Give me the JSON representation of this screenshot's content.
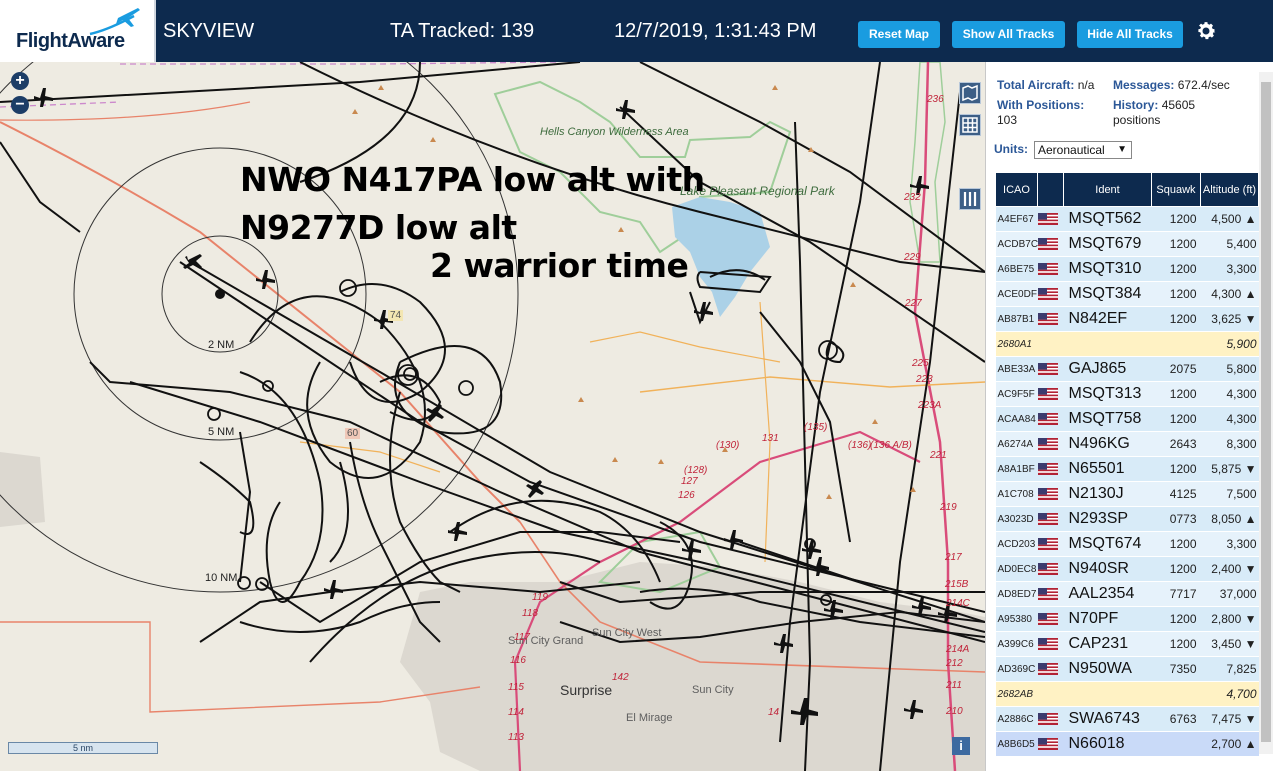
{
  "header": {
    "logo": "FlightAware",
    "app_name": "SKYVIEW",
    "tracked": "TA Tracked: 139",
    "datetime": "12/7/2019, 1:31:43 PM",
    "buttons": {
      "reset": "Reset Map",
      "show_all": "Show All Tracks",
      "hide_all": "Hide All Tracks"
    }
  },
  "colors": {
    "header_bg": "#0d2a4e",
    "button": "#1a9ce0",
    "table_header": "#0d2a4e",
    "row": "#d8ebf8",
    "row_no_ident": "#fff2c4",
    "row_selected": "#c9daf8"
  },
  "map": {
    "annotations": [
      "NWO N417PA low alt with",
      "N9277D low alt",
      "2 warrior time"
    ],
    "place_labels": {
      "hells_canyon": "Hells Canyon Wilderness Area",
      "lake_pleasant": "Lake Pleasant Regional Park",
      "sun_city_grand": "Sun City Grand",
      "sun_city_west": "Sun City West",
      "surprise": "Surprise",
      "sun_city": "Sun City",
      "el_mirage": "El Mirage"
    },
    "range_rings": [
      "2 NM",
      "5 NM",
      "10 NM"
    ],
    "highway_labels": [
      "74",
      "60",
      "(130)",
      "131",
      "(135)",
      "(128)",
      "127",
      "126",
      "(136)",
      "(136 A/B)",
      "236",
      "232",
      "229",
      "227",
      "225",
      "223",
      "223A",
      "221",
      "219",
      "217",
      "215B",
      "214C",
      "214A",
      "212",
      "211",
      "210",
      "119",
      "118",
      "117",
      "116",
      "115",
      "114",
      "113",
      "142",
      "14"
    ],
    "scale": "5 nm",
    "controls": {
      "zoom_in": "+",
      "zoom_out": "−",
      "info": "i"
    }
  },
  "panel": {
    "stats": {
      "total_aircraft_label": "Total Aircraft:",
      "total_aircraft_value": "n/a",
      "with_positions_label": "With Positions:",
      "with_positions_value": "103",
      "messages_label": "Messages:",
      "messages_value": "672.4/sec",
      "history_label": "History:",
      "history_value": "45605 positions"
    },
    "units_label": "Units:",
    "units_value": "Aeronautical",
    "columns": {
      "icao": "ICAO",
      "ident": "Ident",
      "squawk": "Squawk",
      "altitude": "Altitude (ft)"
    },
    "rows": [
      {
        "icao": "A4EF67",
        "ident": "MSQT562",
        "squawk": "1200",
        "altitude": "4,500 ▲"
      },
      {
        "icao": "ACDB7C",
        "ident": "MSQT679",
        "squawk": "1200",
        "altitude": "5,400"
      },
      {
        "icao": "A6BE75",
        "ident": "MSQT310",
        "squawk": "1200",
        "altitude": "3,300"
      },
      {
        "icao": "ACE0DF",
        "ident": "MSQT384",
        "squawk": "1200",
        "altitude": "4,300 ▲"
      },
      {
        "icao": "AB87B1",
        "ident": "N842EF",
        "squawk": "1200",
        "altitude": "3,625 ▼"
      },
      {
        "icao": "2680A1",
        "ident": "",
        "squawk": "",
        "altitude": "5,900",
        "style": "hl"
      },
      {
        "icao": "ABE33A",
        "ident": "GAJ865",
        "squawk": "2075",
        "altitude": "5,800"
      },
      {
        "icao": "AC9F5F",
        "ident": "MSQT313",
        "squawk": "1200",
        "altitude": "4,300"
      },
      {
        "icao": "ACAA84",
        "ident": "MSQT758",
        "squawk": "1200",
        "altitude": "4,300"
      },
      {
        "icao": "A6274A",
        "ident": "N496KG",
        "squawk": "2643",
        "altitude": "8,300"
      },
      {
        "icao": "A8A1BF",
        "ident": "N65501",
        "squawk": "1200",
        "altitude": "5,875 ▼"
      },
      {
        "icao": "A1C708",
        "ident": "N2130J",
        "squawk": "4125",
        "altitude": "7,500"
      },
      {
        "icao": "A3023D",
        "ident": "N293SP",
        "squawk": "0773",
        "altitude": "8,050 ▲"
      },
      {
        "icao": "ACD203",
        "ident": "MSQT674",
        "squawk": "1200",
        "altitude": "3,300"
      },
      {
        "icao": "AD0EC8",
        "ident": "N940SR",
        "squawk": "1200",
        "altitude": "2,400 ▼"
      },
      {
        "icao": "AD8ED7",
        "ident": "AAL2354",
        "squawk": "7717",
        "altitude": "37,000"
      },
      {
        "icao": "A95380",
        "ident": "N70PF",
        "squawk": "1200",
        "altitude": "2,800 ▼"
      },
      {
        "icao": "A399C6",
        "ident": "CAP231",
        "squawk": "1200",
        "altitude": "3,450 ▼"
      },
      {
        "icao": "AD369C",
        "ident": "N950WA",
        "squawk": "7350",
        "altitude": "7,825"
      },
      {
        "icao": "2682AB",
        "ident": "",
        "squawk": "",
        "altitude": "4,700",
        "style": "hl"
      },
      {
        "icao": "A2886C",
        "ident": "SWA6743",
        "squawk": "6763",
        "altitude": "7,475 ▼"
      },
      {
        "icao": "A8B6D5",
        "ident": "N66018",
        "squawk": "",
        "altitude": "2,700 ▲",
        "style": "sel"
      }
    ]
  }
}
